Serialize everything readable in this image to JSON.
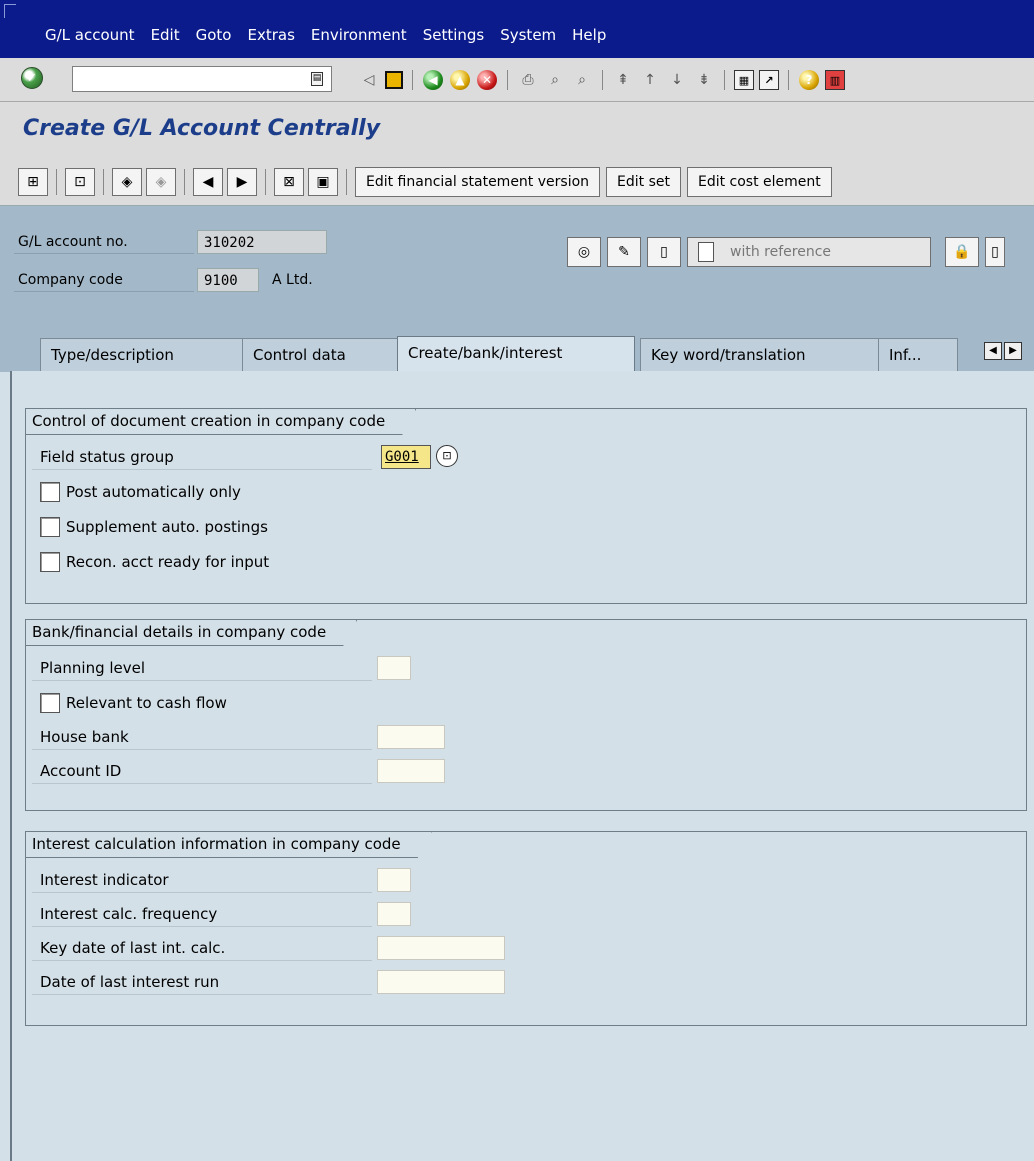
{
  "menu": {
    "items": [
      "G/L account",
      "Edit",
      "Goto",
      "Extras",
      "Environment",
      "Settings",
      "System",
      "Help"
    ]
  },
  "std_toolbar": {
    "command_field_value": "",
    "icons": [
      "enter-icon",
      "back-icon",
      "exit-icon",
      "cancel-icon",
      "print-icon",
      "find-icon",
      "find-next-icon",
      "first-page-icon",
      "previous-page-icon",
      "next-page-icon",
      "last-page-icon",
      "create-session-icon",
      "shortcut-icon",
      "help-icon",
      "layout-icon"
    ]
  },
  "title": "Create G/L Account Centrally",
  "app_toolbar": {
    "buttons": [
      "Edit financial statement version",
      "Edit set",
      "Edit cost element"
    ]
  },
  "header": {
    "gl_account_label": "G/L account no.",
    "gl_account_value": "310202",
    "company_code_label": "Company code",
    "company_code_value": "9100",
    "company_name": "A Ltd.",
    "with_reference_label": "with reference"
  },
  "tabs": [
    {
      "label": "Type/description",
      "active": false
    },
    {
      "label": "Control data",
      "active": false
    },
    {
      "label": "Create/bank/interest",
      "active": true
    },
    {
      "label": "Key word/translation",
      "active": false
    },
    {
      "label": "Inf...",
      "active": false
    }
  ],
  "groups": {
    "doc_creation": {
      "title": "Control of document creation in company code",
      "field_status_group_label": "Field status group",
      "field_status_group_value": "G001",
      "post_auto_only": "Post automatically only",
      "supplement_auto": "Supplement auto. postings",
      "recon_ready": "Recon. acct ready for input"
    },
    "bank": {
      "title": "Bank/financial details in company code",
      "planning_level": "Planning level",
      "relevant_cash_flow": "Relevant to cash flow",
      "house_bank": "House bank",
      "account_id": "Account ID"
    },
    "interest": {
      "title": "Interest calculation information in company code",
      "interest_indicator": "Interest indicator",
      "interest_freq": "Interest calc. frequency",
      "key_date_last": "Key date of last int. calc.",
      "date_last_run": "Date of last interest run"
    }
  }
}
